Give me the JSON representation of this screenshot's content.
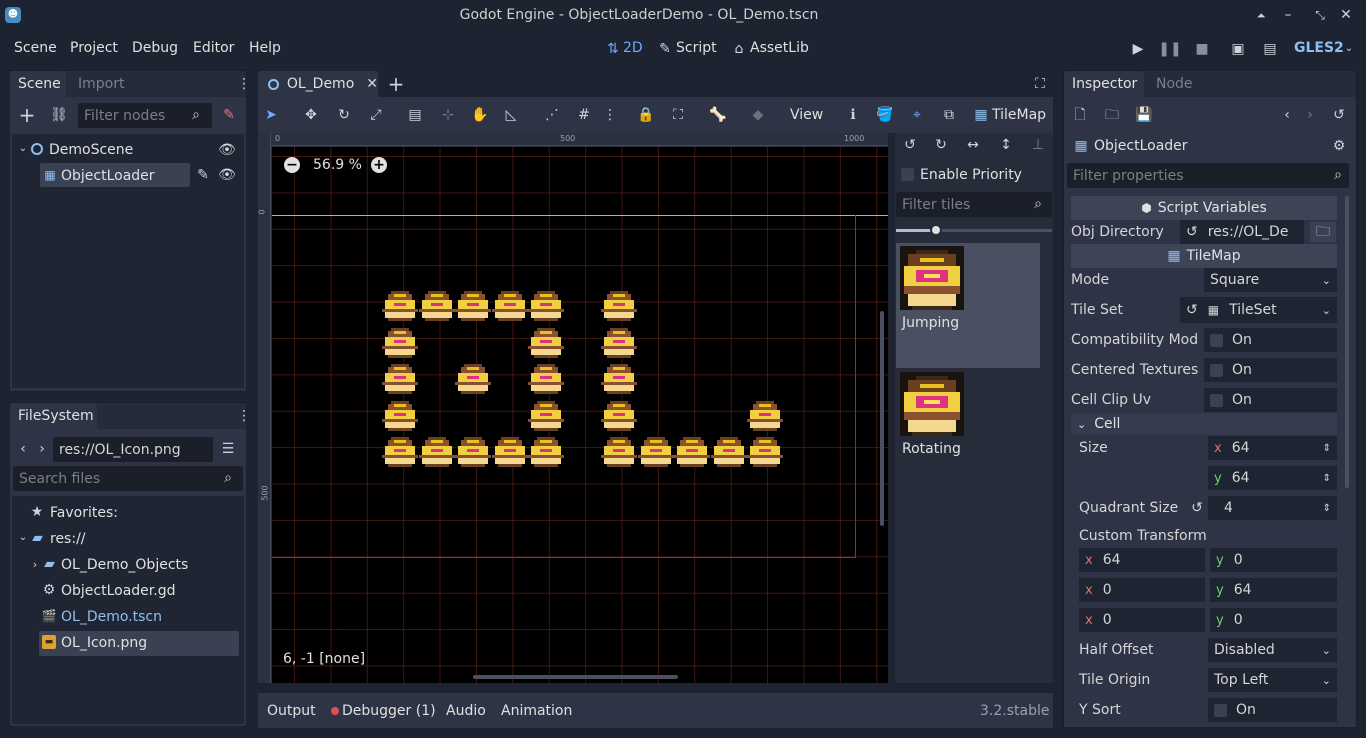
{
  "window": {
    "title": "Godot Engine - ObjectLoaderDemo - OL_Demo.tscn"
  },
  "menu": {
    "items": [
      "Scene",
      "Project",
      "Debug",
      "Editor",
      "Help"
    ]
  },
  "workspaces": {
    "two_d": "2D",
    "script": "Script",
    "assetlib": "AssetLib"
  },
  "renderer": "GLES2",
  "scene_dock": {
    "tab_scene": "Scene",
    "tab_import": "Import",
    "filter_placeholder": "Filter nodes",
    "nodes": [
      "DemoScene",
      "ObjectLoader"
    ]
  },
  "filesystem": {
    "tab": "FileSystem",
    "path": "res://OL_Icon.png",
    "search_placeholder": "Search files",
    "items": [
      "Favorites:",
      "res://",
      "OL_Demo_Objects",
      "ObjectLoader.gd",
      "OL_Demo.tscn",
      "OL_Icon.png"
    ]
  },
  "editor": {
    "tab": "OL_Demo",
    "view_menu": "View",
    "tilemap_label": "TileMap",
    "zoom": "56.9 %",
    "coords": "6, -1 [none]",
    "ruler": [
      "0",
      "500",
      "1000"
    ],
    "ruler_v": [
      "0",
      "500"
    ]
  },
  "tile_palette": {
    "enable_priority": "Enable Priority",
    "filter_placeholder": "Filter tiles",
    "tiles": [
      "Jumping",
      "Rotating"
    ]
  },
  "bottom_panel": {
    "tabs": [
      "Output",
      "Debugger (1)",
      "Audio",
      "Animation"
    ],
    "version": "3.2.stable"
  },
  "inspector": {
    "tab_inspector": "Inspector",
    "tab_node": "Node",
    "object": "ObjectLoader",
    "filter_placeholder": "Filter properties",
    "script_variables": "Script Variables",
    "obj_directory_label": "Obj Directory",
    "obj_directory_value": "res://OL_De",
    "tilemap_section": "TileMap",
    "mode_label": "Mode",
    "mode_value": "Square",
    "tileset_label": "Tile Set",
    "tileset_value": "TileSet",
    "compat_label": "Compatibility Mod",
    "compat_value": "On",
    "centered_label": "Centered Textures",
    "centered_value": "On",
    "clipuv_label": "Cell Clip Uv",
    "clipuv_value": "On",
    "cell_section": "Cell",
    "size_label": "Size",
    "size_x": "64",
    "size_y": "64",
    "quadrant_label": "Quadrant Size",
    "quadrant_value": "4",
    "custom_transform_label": "Custom Transform",
    "transform": [
      [
        "64",
        "0"
      ],
      [
        "0",
        "64"
      ],
      [
        "0",
        "0"
      ]
    ],
    "half_offset_label": "Half Offset",
    "half_offset_value": "Disabled",
    "tile_origin_label": "Tile Origin",
    "tile_origin_value": "Top Left",
    "ysort_label": "Y Sort",
    "ysort_value": "On",
    "axis_x": "x",
    "axis_y": "y"
  },
  "colors": {
    "accent": "#6ea8ff",
    "background": "#1d2330",
    "panel": "#252b39"
  }
}
